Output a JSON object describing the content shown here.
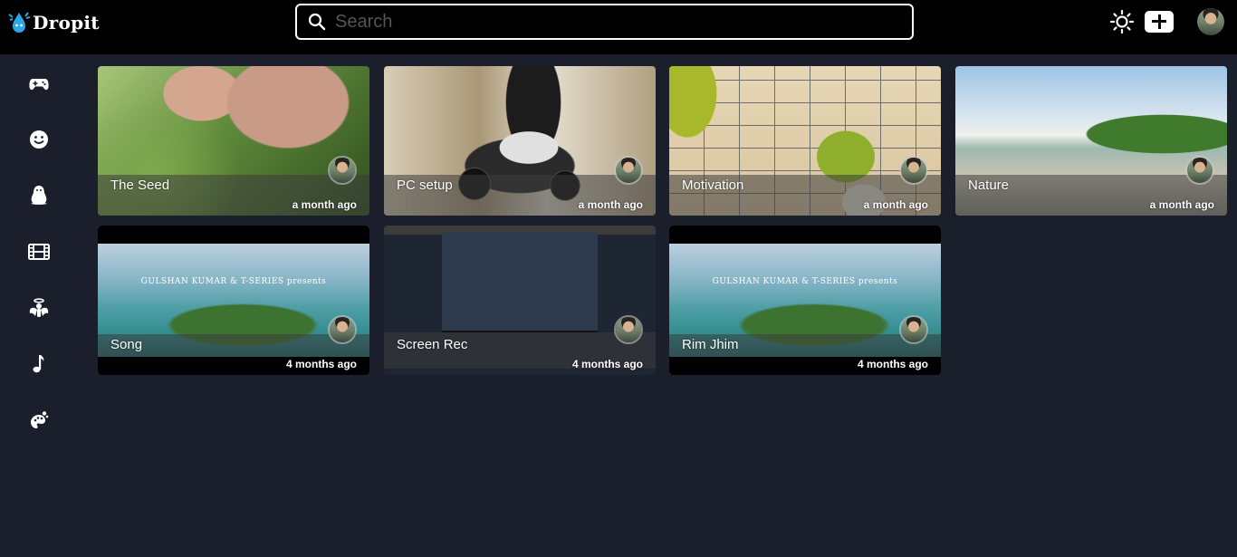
{
  "app": {
    "name": "Dropit"
  },
  "search": {
    "placeholder": "Search",
    "value": ""
  },
  "header": {
    "icons": [
      "sun-icon",
      "plus-icon",
      "avatar"
    ]
  },
  "sidebar": {
    "items": [
      {
        "name": "gaming",
        "icon": "gamepad-icon"
      },
      {
        "name": "comedy",
        "icon": "smile-icon"
      },
      {
        "name": "tech",
        "icon": "penguin-icon"
      },
      {
        "name": "movies",
        "icon": "film-icon"
      },
      {
        "name": "spiritual",
        "icon": "angel-icon"
      },
      {
        "name": "music",
        "icon": "music-note-icon"
      },
      {
        "name": "art",
        "icon": "palette-icon"
      }
    ]
  },
  "videos": [
    {
      "title": "The Seed",
      "time": "a month ago"
    },
    {
      "title": "PC setup",
      "time": "a month ago"
    },
    {
      "title": "Motivation",
      "time": "a month ago"
    },
    {
      "title": "Nature",
      "time": "a month ago"
    },
    {
      "title": "Song",
      "time": "4 months ago",
      "overlay_text": "GULSHAN KUMAR & T-SERIES presents"
    },
    {
      "title": "Screen Rec",
      "time": "4 months ago"
    },
    {
      "title": "Rim Jhim",
      "time": "4 months ago",
      "overlay_text": "GULSHAN KUMAR & T-SERIES presents"
    }
  ],
  "colors": {
    "background": "#1b1f2c",
    "topbar": "#000000",
    "text": "#ffffff"
  }
}
